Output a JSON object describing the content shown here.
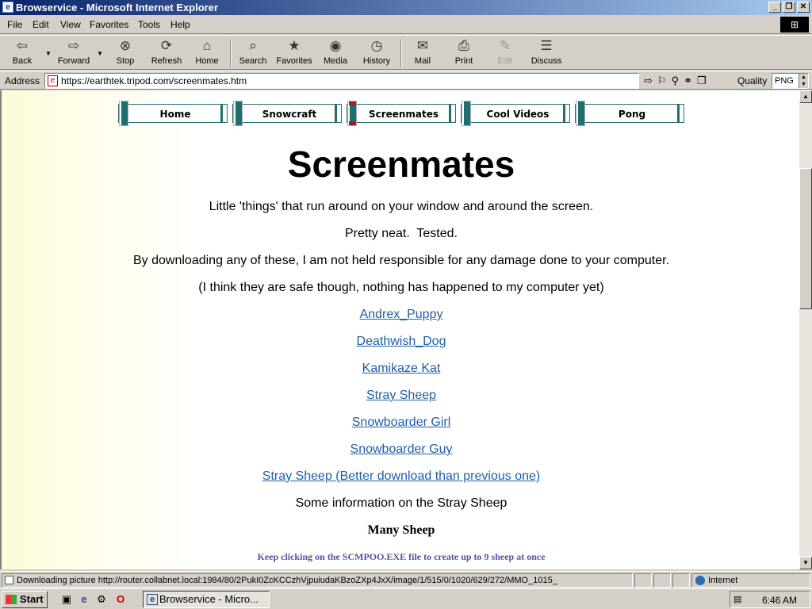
{
  "window": {
    "title": "Browservice - Microsoft Internet Explorer"
  },
  "menu": [
    "File",
    "Edit",
    "View",
    "Favorites",
    "Tools",
    "Help"
  ],
  "toolbar": {
    "back": "Back",
    "forward": "Forward",
    "stop": "Stop",
    "refresh": "Refresh",
    "home": "Home",
    "search": "Search",
    "favorites": "Favorites",
    "media": "Media",
    "history": "History",
    "mail": "Mail",
    "print": "Print",
    "edit": "Edit",
    "discuss": "Discuss"
  },
  "address": {
    "label": "Address",
    "url": "https://earthtek.tripod.com/screenmates.htm"
  },
  "quality": {
    "label": "Quality",
    "value": "PNG"
  },
  "page": {
    "nav": [
      "Home",
      "Snowcraft",
      "Screenmates",
      "Cool Videos",
      "Pong"
    ],
    "active_nav": "Screenmates",
    "title": "Screenmates",
    "intro": [
      "Little 'things' that run around on your window and around the screen.",
      "Pretty neat.  Tested.",
      "By downloading any of these, I am not held responsible for any damage done to your computer.",
      "(I think they are safe though, nothing has happened to my computer yet)"
    ],
    "links": [
      "Andrex_Puppy",
      "Deathwish_Dog",
      "Kamikaze Kat",
      "Stray Sheep",
      "Snowboarder Girl",
      "Snowboarder Guy",
      "Stray Sheep (Better download than previous one)"
    ],
    "info_text": "Some information on the Stray Sheep",
    "subheading": "Many Sheep",
    "note": "Keep clicking on the SCMPOO.EXE file to create up to 9 sheep at once"
  },
  "status": {
    "text": "Downloading picture http://router.collabnet.local:1984/80/2PukI0ZcKCCzhVjpuiudaKBzoZXp4JxX/image/1/515/0/1020/629/272/MMO_1015_",
    "zone": "Internet"
  },
  "taskbar": {
    "start": "Start",
    "task": "Browservice - Micro...",
    "clock": "6:46 AM"
  }
}
